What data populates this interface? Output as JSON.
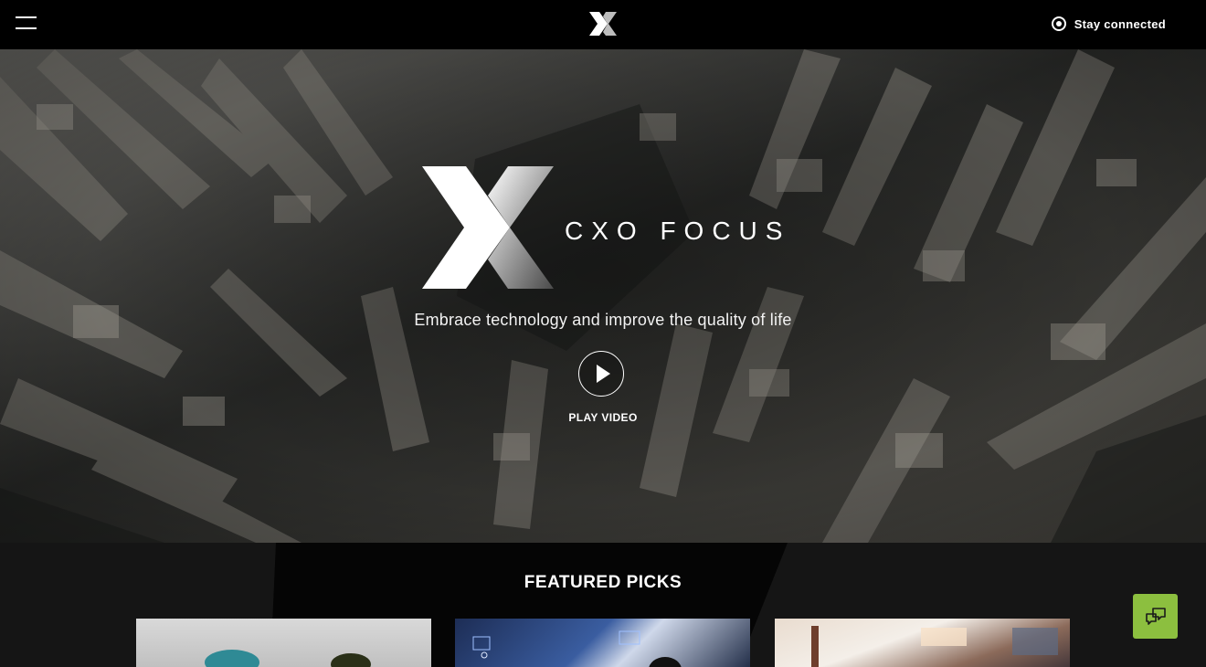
{
  "header": {
    "stay_connected_label": "Stay connected"
  },
  "hero": {
    "brand_name": "CXO FOCUS",
    "tagline": "Embrace technology and improve the quality of life",
    "play_label": "PLAY VIDEO"
  },
  "featured": {
    "title": "FEATURED PICKS",
    "cards": [
      {
        "image": "featured-pick-image-1"
      },
      {
        "image": "featured-pick-image-2"
      },
      {
        "image": "featured-pick-image-3"
      }
    ]
  },
  "icons": {
    "menu": "hamburger-menu-icon",
    "logo": "x-logo-icon",
    "stay": "radio-dot-icon",
    "play": "play-icon",
    "chat": "chat-bubbles-icon"
  },
  "colors": {
    "background": "#000000",
    "featured_bg": "#151515",
    "chat_button": "#8cbf3f",
    "text": "#ffffff"
  }
}
